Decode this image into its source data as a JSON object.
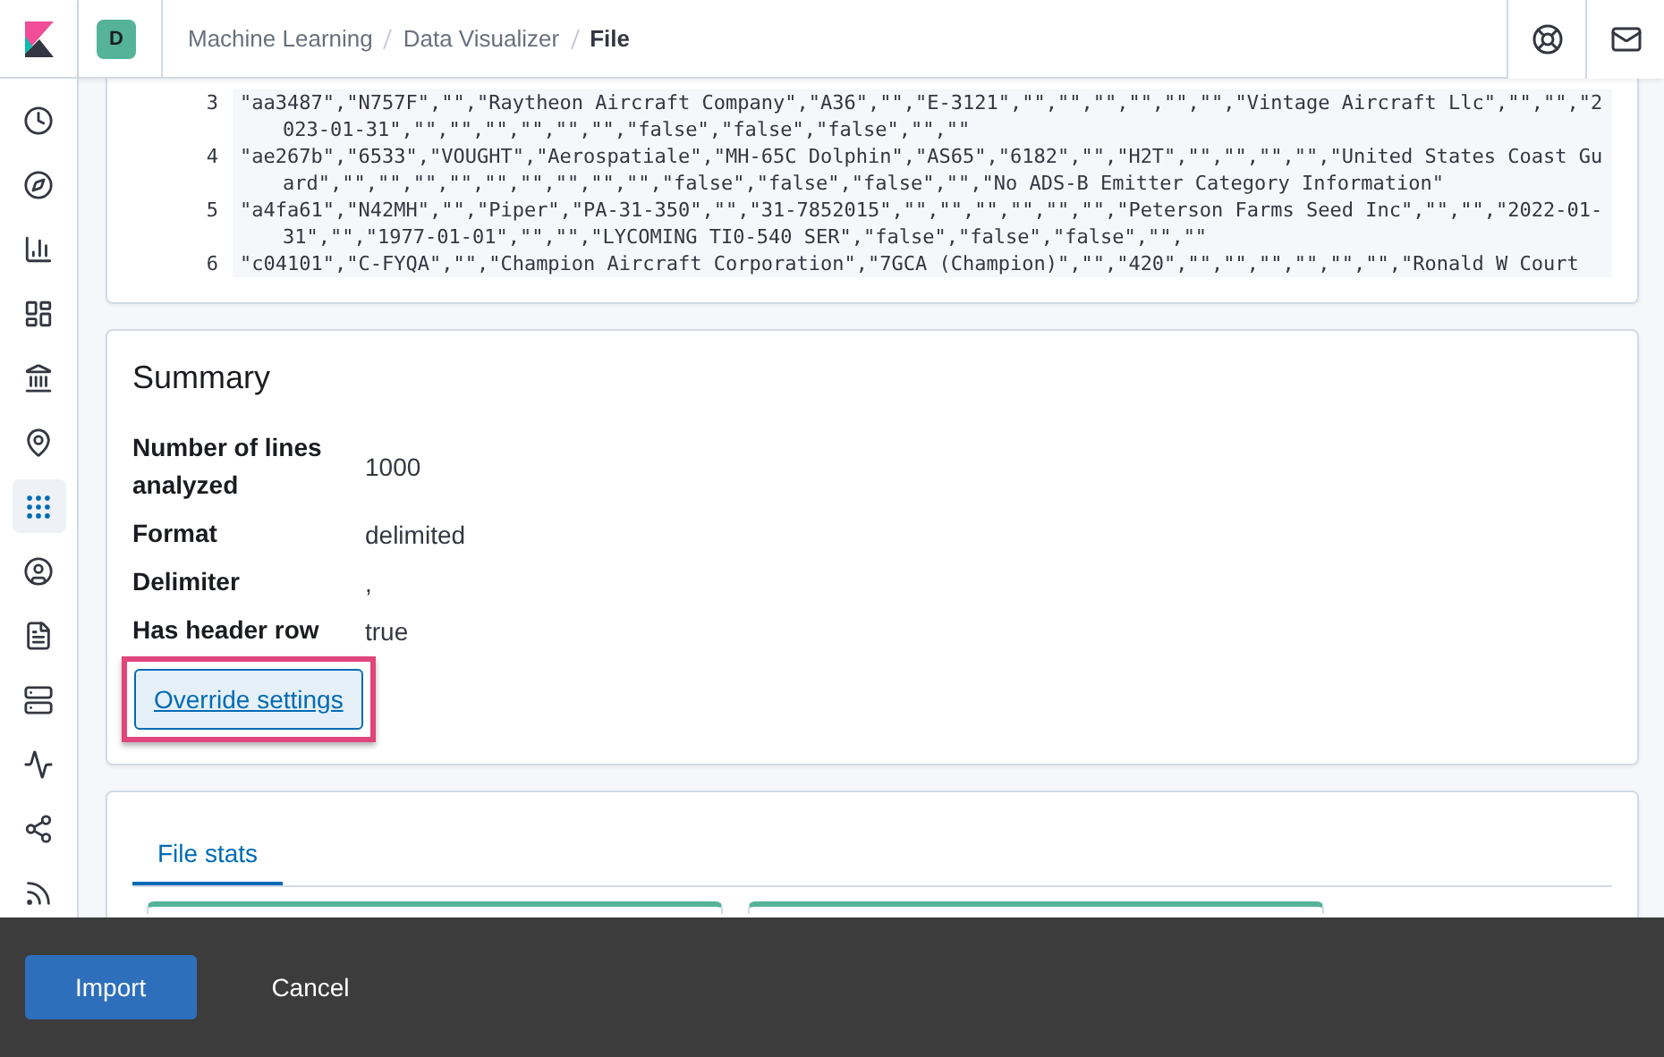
{
  "header": {
    "space_avatar": "D",
    "breadcrumbs": [
      {
        "label": "Machine Learning",
        "current": false
      },
      {
        "label": "Data Visualizer",
        "current": false
      },
      {
        "label": "File",
        "current": true
      }
    ]
  },
  "sidebar": {
    "items": [
      {
        "selected": false
      },
      {
        "selected": false
      },
      {
        "selected": false
      },
      {
        "selected": false
      },
      {
        "selected": false
      },
      {
        "selected": false
      },
      {
        "selected": true
      },
      {
        "selected": false
      },
      {
        "selected": false
      },
      {
        "selected": false
      },
      {
        "selected": false
      },
      {
        "selected": false
      },
      {
        "selected": false
      }
    ]
  },
  "file_contents": {
    "lines": [
      {
        "number": "3",
        "text": "\"aa3487\",\"N757F\",\"\",\"Raytheon Aircraft Company\",\"A36\",\"\",\"E-3121\",\"\",\"\",\"\",\"\",\"\",\"\",\"Vintage Aircraft Llc\",\"\",\"\",\"2023-01-31\",\"\",\"\",\"\",\"\",\"\",\"\",\"false\",\"false\",\"false\",\"\",\"\""
      },
      {
        "number": "4",
        "text": "\"ae267b\",\"6533\",\"VOUGHT\",\"Aerospatiale\",\"MH-65C Dolphin\",\"AS65\",\"6182\",\"\",\"H2T\",\"\",\"\",\"\",\"\",\"United States Coast Guard\",\"\",\"\",\"\",\"\",\"\",\"\",\"\",\"\",\"\",\"false\",\"false\",\"false\",\"\",\"No ADS-B Emitter Category Information\""
      },
      {
        "number": "5",
        "text": "\"a4fa61\",\"N42MH\",\"\",\"Piper\",\"PA-31-350\",\"\",\"31-7852015\",\"\",\"\",\"\",\"\",\"\",\"\",\"Peterson Farms Seed Inc\",\"\",\"\",\"2022-01-31\",\"\",\"1977-01-01\",\"\",\"\",\"LYCOMING TI0-540 SER\",\"false\",\"false\",\"false\",\"\",\"\""
      },
      {
        "number": "6",
        "text": "\"c04101\",\"C-FYQA\",\"\",\"Champion Aircraft Corporation\",\"7GCA (Champion)\",\"\",\"420\",\"\",\"\",\"\",\"\",\"\",\"\",\"Ronald W Court"
      }
    ]
  },
  "summary": {
    "title": "Summary",
    "rows": [
      {
        "label": "Number of lines analyzed",
        "value": "1000"
      },
      {
        "label": "Format",
        "value": "delimited"
      },
      {
        "label": "Delimiter",
        "value": ","
      },
      {
        "label": "Has header row",
        "value": "true"
      }
    ],
    "override_button": "Override settings",
    "highlighted": true
  },
  "stats": {
    "tabs": [
      {
        "label": "File stats",
        "selected": true
      }
    ],
    "cards": [
      {
        "kind": "field"
      },
      {
        "kind": "field"
      }
    ]
  },
  "footer": {
    "buttons": [
      {
        "label": "Import",
        "kind": "primary"
      },
      {
        "label": "Cancel",
        "kind": "empty"
      }
    ]
  }
}
